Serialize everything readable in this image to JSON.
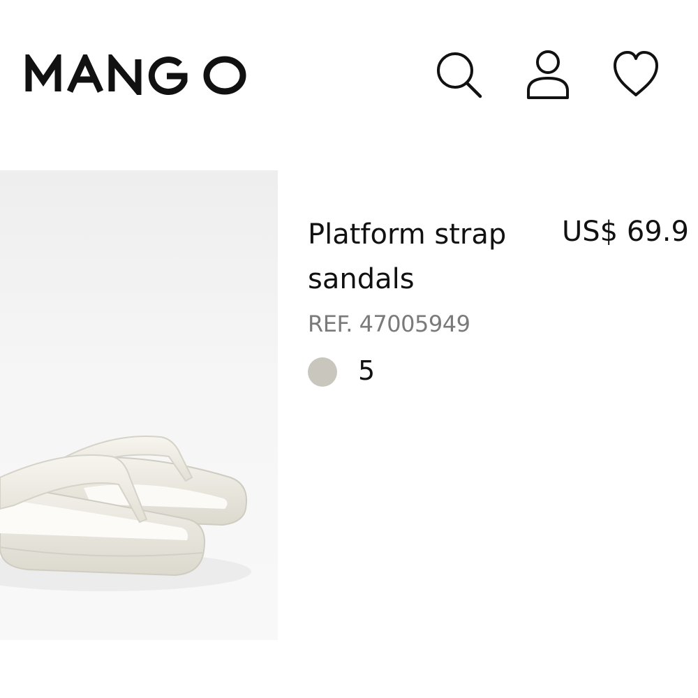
{
  "header": {
    "brand": "MANGO",
    "icons": {
      "search": "search-icon",
      "account": "user-icon",
      "wishlist": "heart-icon"
    }
  },
  "product": {
    "image_alt": "white platform flip flop sandals",
    "title": "Platform strap sandals",
    "price": "US$ 69.9",
    "ref": "REF. 47005949",
    "colors": {
      "swatch_color": "#c9c6bd",
      "count": "5"
    }
  }
}
